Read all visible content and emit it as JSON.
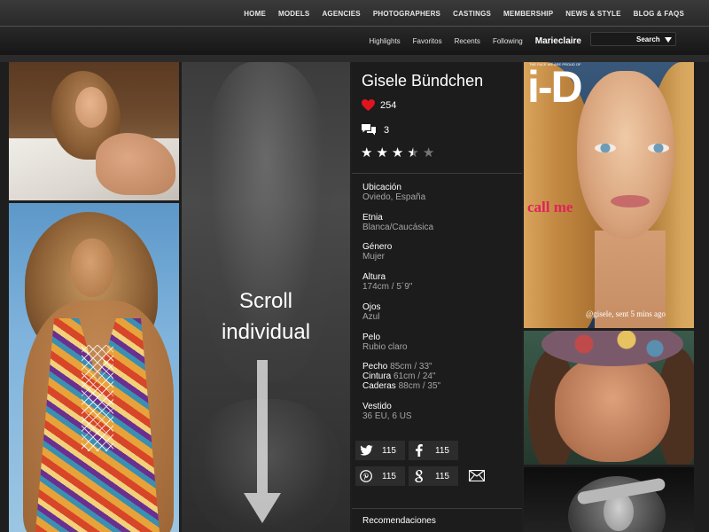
{
  "nav": {
    "main": [
      "HOME",
      "MODELS",
      "AGENCIES",
      "PHOTOGRAPHERS",
      "CASTINGS",
      "MEMBERSHIP",
      "NEWS & STYLE",
      "BLOG & FAQS"
    ],
    "sub": [
      "Highlights",
      "Favoritos",
      "Recents",
      "Following"
    ],
    "brand": "Marieclaire",
    "search_label": "Search"
  },
  "scroll_hint": {
    "line1": "Scroll",
    "line2": "individual"
  },
  "profile": {
    "name": "Gisele Bündchen",
    "likes": "254",
    "comments": "3",
    "rating": 3.5,
    "rating_max": 5,
    "fields": [
      {
        "label": "Ubicación",
        "value": "Oviedo, España"
      },
      {
        "label": "Etnia",
        "value": "Blanca/Caucásica"
      },
      {
        "label": "Género",
        "value": "Mujer"
      },
      {
        "label": "Altura",
        "value": "174cm / 5´9\""
      },
      {
        "label": "Ojos",
        "value": "Azul"
      },
      {
        "label": "Pelo",
        "value": "Rubio claro"
      }
    ],
    "measures": [
      {
        "label": "Pecho",
        "value": "85cm / 33\""
      },
      {
        "label": "Cintura",
        "value": "61cm / 24\""
      },
      {
        "label": "Caderas",
        "value": "88cm / 35\""
      }
    ],
    "dress": {
      "label": "Vestido",
      "value": "36 EU, 6 US"
    },
    "shares": {
      "twitter": "115",
      "facebook": "115",
      "pinterest": "115",
      "google": "115"
    },
    "recommendations_label": "Recomendaciones"
  },
  "cover": {
    "logo": "i-D",
    "tagline_small": "THE FACE WE ARE PROUD OF",
    "headline": "call me",
    "caption": "@gisele, sent 5 mins ago"
  },
  "colors": {
    "accent_heart": "#e0141e",
    "headline_pink": "#e0225c"
  }
}
